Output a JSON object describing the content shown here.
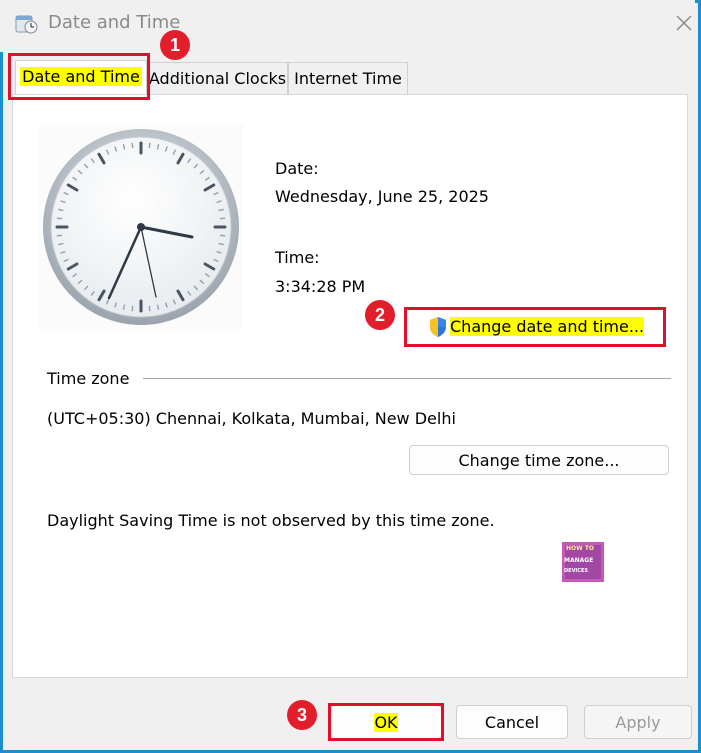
{
  "window": {
    "title": "Date and Time"
  },
  "tabs": [
    {
      "label": "Date and Time",
      "active": true
    },
    {
      "label": "Additional Clocks",
      "active": false
    },
    {
      "label": "Internet Time",
      "active": false
    }
  ],
  "datetime": {
    "date_label": "Date:",
    "date_value": "Wednesday, June 25, 2025",
    "time_label": "Time:",
    "time_value": "3:34:28 PM",
    "change_button": "Change date and time..."
  },
  "timezone": {
    "section_label": "Time zone",
    "value": "(UTC+05:30) Chennai, Kolkata, Mumbai, New Delhi",
    "change_button": "Change time zone...",
    "dst_note": "Daylight Saving Time is not observed by this time zone."
  },
  "footer": {
    "ok": "OK",
    "cancel": "Cancel",
    "apply": "Apply"
  },
  "annotations": {
    "step1": "1",
    "step2": "2",
    "step3": "3"
  },
  "logo": {
    "line1": "HOW TO",
    "line2": "MANAGE",
    "line3": "DEVICES"
  },
  "colors": {
    "highlight": "#ffff00",
    "annotation_red": "#e0102b",
    "frame_blue": "#1d8fd0"
  }
}
